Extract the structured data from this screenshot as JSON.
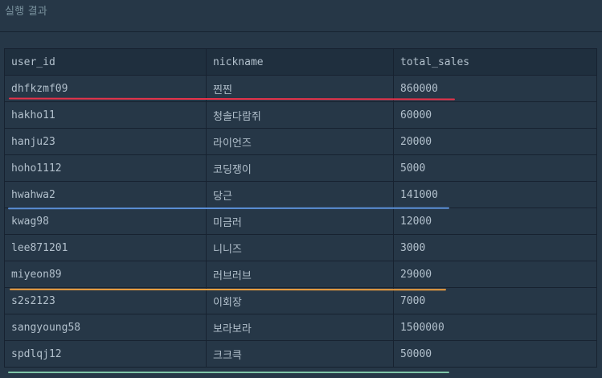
{
  "result": {
    "title": "실행 결과"
  },
  "table": {
    "columns": [
      "user_id",
      "nickname",
      "total_sales"
    ],
    "rows": [
      {
        "user_id": "dhfkzmf09",
        "nickname": "찐찐",
        "total_sales": "860000"
      },
      {
        "user_id": "hakho11",
        "nickname": "청솔다람쥐",
        "total_sales": "60000"
      },
      {
        "user_id": "hanju23",
        "nickname": "라이언즈",
        "total_sales": "20000"
      },
      {
        "user_id": "hoho1112",
        "nickname": "코딩쟁이",
        "total_sales": "5000"
      },
      {
        "user_id": "hwahwa2",
        "nickname": "당근",
        "total_sales": "141000"
      },
      {
        "user_id": "kwag98",
        "nickname": "미금러",
        "total_sales": "12000"
      },
      {
        "user_id": "lee871201",
        "nickname": "니니즈",
        "total_sales": "3000"
      },
      {
        "user_id": "miyeon89",
        "nickname": "러브러브",
        "total_sales": "29000"
      },
      {
        "user_id": "s2s2123",
        "nickname": "이회장",
        "total_sales": "7000"
      },
      {
        "user_id": "sangyoung58",
        "nickname": "보라보라",
        "total_sales": "1500000"
      },
      {
        "user_id": "spdlqj12",
        "nickname": "크크큭",
        "total_sales": "50000"
      }
    ]
  },
  "highlights": {
    "colors": [
      "#e8334a",
      "#5b8fd6",
      "#f0a040",
      "#7fc6a8"
    ]
  }
}
